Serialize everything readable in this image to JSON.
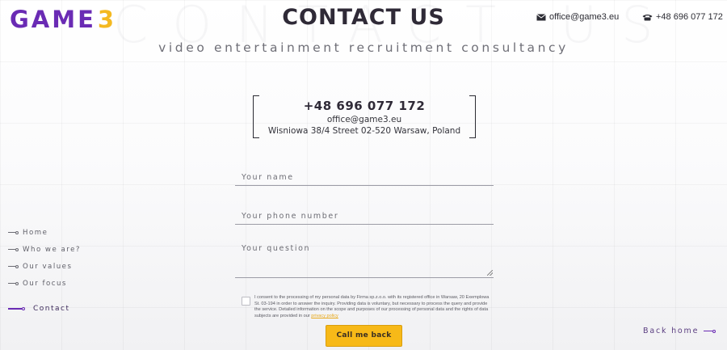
{
  "header": {
    "logo_text": "GAME",
    "logo_number": "3",
    "background_title": "CONTACT US",
    "title": "CONTACT US",
    "subtitle": "video entertainment recruitment consultancy",
    "email": "office@game3.eu",
    "phone": "+48 696 077 172",
    "email_icon": "envelope-icon",
    "phone_icon": "phone-icon"
  },
  "contact_card": {
    "phone": "+48 696 077 172",
    "email": "office@game3.eu",
    "address": "Wisniowa 38/4 Street 02-520 Warsaw, Poland"
  },
  "form": {
    "name_placeholder": "Your name",
    "phone_placeholder": "Your phone number",
    "question_placeholder": "Your question",
    "consent_text": "I consent to the processing of my personal data by Firma sp.z.o.o. with its registered office in Warsaw, 20 Exemplowa St. 03-194 in order to answer the inquiry. Providing data is voluntary, but necessary to process the query and provide the service. Detailed information on the scope and purposes of our processing of personal data and the rights of data subjects are provided in our",
    "consent_link": "privacy policy",
    "consent_checked": false,
    "submit_label": "Call me back"
  },
  "nav": {
    "items": [
      {
        "label": "Home"
      },
      {
        "label": "Who we are?"
      },
      {
        "label": "Our values"
      },
      {
        "label": "Our focus"
      }
    ],
    "active_label": "Contact"
  },
  "back_home_label": "Back home",
  "colors": {
    "brand_purple": "#6a2bb4",
    "brand_yellow": "#f4b921",
    "button_yellow": "#f7b918"
  }
}
